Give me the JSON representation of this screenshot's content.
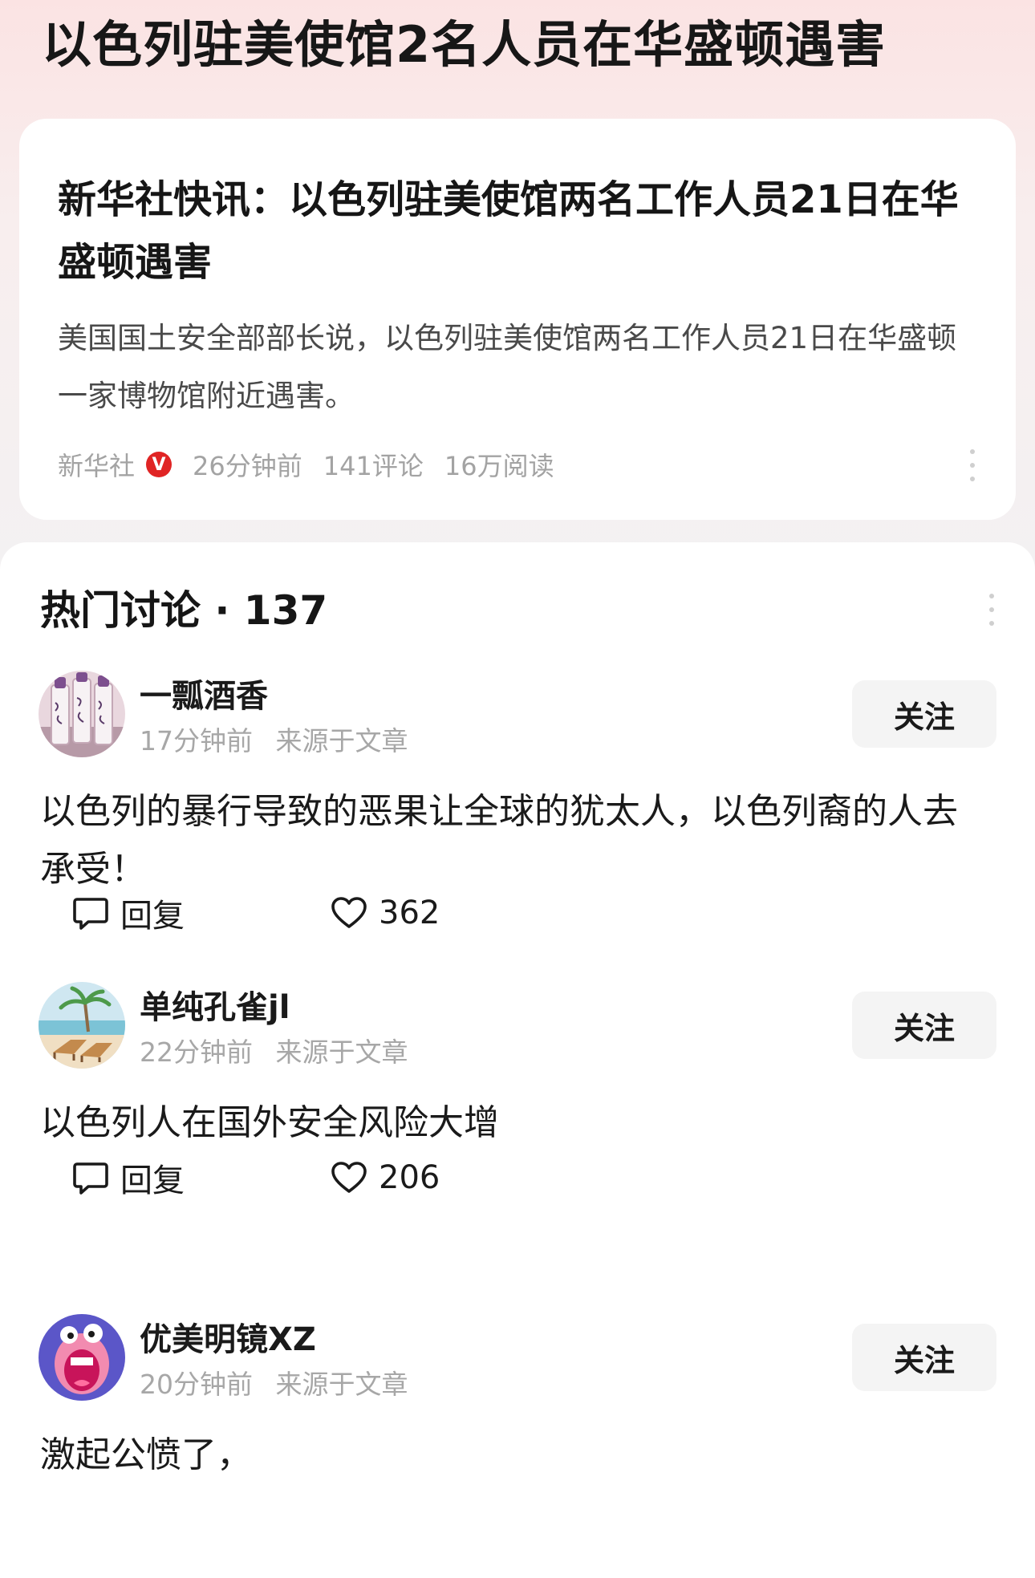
{
  "page": {
    "title": "以色列驻美使馆2名人员在华盛顿遇害"
  },
  "news": {
    "headline": "新华社快讯：以色列驻美使馆两名工作人员21日在华盛顿遇害",
    "summary": "美国国土安全部部长说，以色列驻美使馆两名工作人员21日在华盛顿一家博物馆附近遇害。",
    "source": "新华社",
    "verified_mark": "V",
    "time": "26分钟前",
    "comments": "141评论",
    "reads": "16万阅读"
  },
  "discussion": {
    "header": "热门讨论 · 137",
    "follow_label": "关注",
    "reply_label": "回复",
    "comments": [
      {
        "username": "一瓢酒香",
        "time": "17分钟前",
        "source": "来源于文章",
        "text": "以色列的暴行导致的恶果让全球的犹太人，以色列裔的人去承受！",
        "likes": "362",
        "avatar_icon": "calligraphy-scroll-avatar"
      },
      {
        "username": "单纯孔雀jl",
        "time": "22分钟前",
        "source": "来源于文章",
        "text": "以色列人在国外安全风险大增",
        "likes": "206",
        "avatar_icon": "beach-chairs-avatar"
      },
      {
        "username": "优美明镜XZ",
        "time": "20分钟前",
        "source": "来源于文章",
        "text": "激起公愤了，",
        "avatar_icon": "screaming-cartoon-avatar"
      }
    ]
  },
  "colors": {
    "verified_badge": "#e02424",
    "header_gradient": "#fbe3e3",
    "follow_button_bg": "#f4f4f4",
    "meta_text": "#a3a3a3"
  }
}
